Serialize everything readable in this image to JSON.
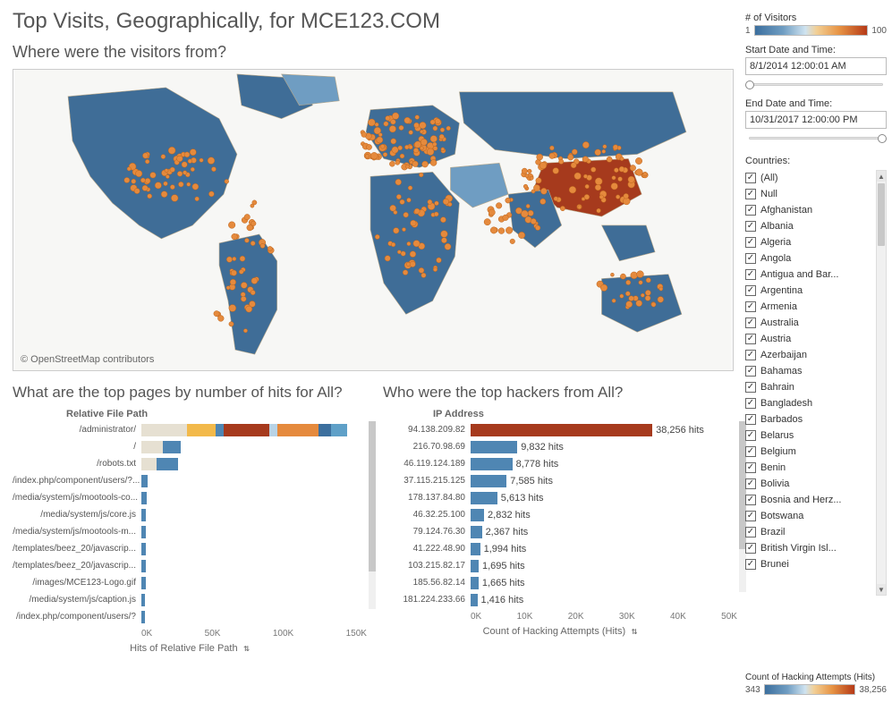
{
  "title": "Top Visits, Geographically, for MCE123.COM",
  "map": {
    "title": "Where were the visitors from?",
    "attribution": "© OpenStreetMap contributors"
  },
  "visitors_legend": {
    "label": "# of Visitors",
    "min": "1",
    "max": "100",
    "gradient_css": "linear-gradient(90deg,#3c6f9e 0%,#6f9dc2 25%,#cfe3f0 45%,#f2cf95 55%,#e79445 75%,#b63a17 100%)"
  },
  "start": {
    "label": "Start Date and Time:",
    "value": "8/1/2014 12:00:01 AM",
    "thumb_pct": 0
  },
  "end": {
    "label": "End Date and Time:",
    "value": "10/31/2017 12:00:00 PM",
    "thumb_pct": 100
  },
  "countries_label": "Countries:",
  "countries": [
    "(All)",
    "Null",
    "Afghanistan",
    "Albania",
    "Algeria",
    "Angola",
    "Antigua and Bar...",
    "Argentina",
    "Armenia",
    "Australia",
    "Austria",
    "Azerbaijan",
    "Bahamas",
    "Bahrain",
    "Bangladesh",
    "Barbados",
    "Belarus",
    "Belgium",
    "Benin",
    "Bolivia",
    "Bosnia and Herz...",
    "Botswana",
    "Brazil",
    "British Virgin Isl...",
    "Brunei"
  ],
  "hacking_legend": {
    "label": "Count of Hacking Attempts (Hits)",
    "min": "343",
    "max": "38,256",
    "gradient_css": "linear-gradient(90deg,#3c6f9e 0%,#6f9dc2 25%,#cfe3f0 45%,#f2cf95 55%,#e79445 75%,#b63a17 100%)"
  },
  "pages": {
    "title": "What are the top pages by number of hits for All?",
    "y_label": "Relative File Path",
    "x_label": "Hits of Relative File Path",
    "x_ticks": [
      "0K",
      "50K",
      "100K",
      "150K"
    ],
    "max": 155000
  },
  "hackers": {
    "title": "Who were the top hackers from All?",
    "y_label": "IP Address",
    "x_label": "Count of Hacking Attempts (Hits)",
    "x_ticks": [
      "0K",
      "10K",
      "20K",
      "30K",
      "40K",
      "50K"
    ],
    "max": 55000
  },
  "chart_data": [
    {
      "type": "bar",
      "name": "top_pages",
      "xlabel": "Hits of Relative File Path",
      "ylabel": "Relative File Path",
      "xlim": [
        0,
        155000
      ],
      "labels": [
        "/administrator/",
        "/",
        "/robots.txt",
        "/index.php/component/users/?...",
        "/media/system/js/mootools-co...",
        "/media/system/js/core.js",
        "/media/system/js/mootools-m...",
        "/templates/beez_20/javascrip...",
        "/templates/beez_20/javascrip...",
        "/images/MCE123-Logo.gif",
        "/media/system/js/caption.js",
        "/index.php/component/users/?"
      ],
      "values": [
        145000,
        28000,
        26000,
        4500,
        3500,
        3300,
        3200,
        3100,
        3000,
        2900,
        2800,
        2700
      ],
      "stacked_first_row": {
        "segments": [
          {
            "w": 0.22,
            "color": "#e6e0d2"
          },
          {
            "w": 0.14,
            "color": "#f2b94a"
          },
          {
            "w": 0.04,
            "color": "#4f86b3"
          },
          {
            "w": 0.22,
            "color": "#a63a1d"
          },
          {
            "w": 0.04,
            "color": "#b8d3e6"
          },
          {
            "w": 0.2,
            "color": "#e58a3d"
          },
          {
            "w": 0.06,
            "color": "#3c6f9e"
          },
          {
            "w": 0.08,
            "color": "#5fa0c8"
          }
        ]
      },
      "stacked_second_row": {
        "segments": [
          {
            "w": 0.55,
            "color": "#e6e0d2"
          },
          {
            "w": 0.45,
            "color": "#4f86b3"
          }
        ]
      },
      "stacked_third_row": {
        "segments": [
          {
            "w": 0.4,
            "color": "#e6e0d2"
          },
          {
            "w": 0.6,
            "color": "#4f86b3"
          }
        ]
      }
    },
    {
      "type": "bar",
      "name": "top_hackers",
      "xlabel": "Count of Hacking Attempts (Hits)",
      "ylabel": "IP Address",
      "xlim": [
        0,
        55000
      ],
      "labels": [
        "94.138.209.82",
        "216.70.98.69",
        "46.119.124.189",
        "37.115.215.125",
        "178.137.84.80",
        "46.32.25.100",
        "79.124.76.30",
        "41.222.48.90",
        "103.215.82.17",
        "185.56.82.14",
        "181.224.233.66"
      ],
      "values": [
        38256,
        9832,
        8778,
        7585,
        5613,
        2832,
        2367,
        1994,
        1695,
        1665,
        1416
      ],
      "value_labels": [
        "38,256 hits",
        "9,832 hits",
        "8,778 hits",
        "7,585 hits",
        "5,613 hits",
        "2,832 hits",
        "2,367 hits",
        "1,994 hits",
        "1,695 hits",
        "1,665 hits",
        "1,416 hits"
      ],
      "first_bar_color": "#a63a1d"
    }
  ]
}
